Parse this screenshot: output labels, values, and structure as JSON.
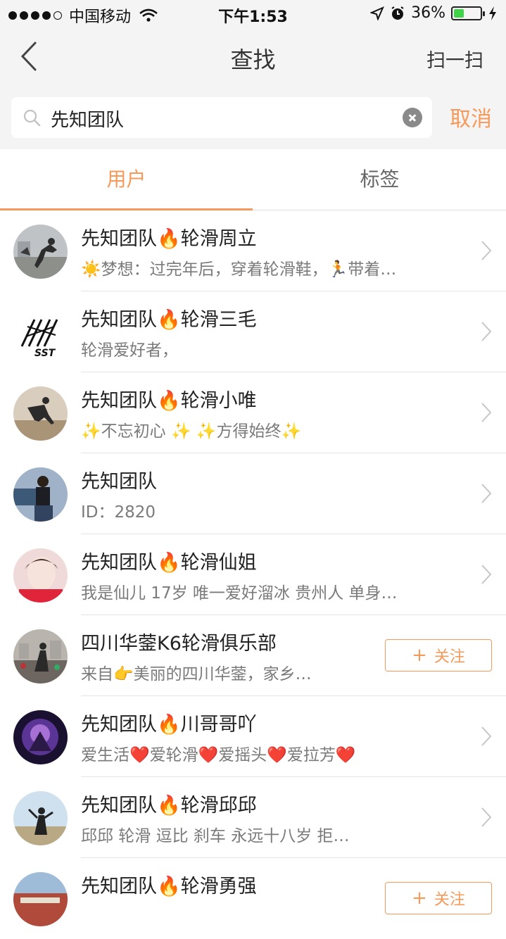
{
  "status_bar": {
    "carrier": "中国移动",
    "time": "下午1:53",
    "battery": "36%"
  },
  "nav": {
    "title": "查找",
    "scan_label": "扫一扫"
  },
  "search": {
    "value": "先知团队",
    "cancel_label": "取消"
  },
  "tabs": [
    {
      "label": "用户",
      "active": true
    },
    {
      "label": "标签",
      "active": false
    }
  ],
  "results": [
    {
      "name": "先知团队🔥轮滑周立",
      "desc": "☀️梦想：过完年后，穿着轮滑鞋，🏃带着…",
      "action": "chevron"
    },
    {
      "name": "先知团队🔥轮滑三毛",
      "desc": "轮滑爱好者，",
      "action": "chevron"
    },
    {
      "name": "先知团队🔥轮滑小唯",
      "desc": "✨不忘初心 ✨  ✨方得始终✨",
      "action": "chevron"
    },
    {
      "name": "先知团队",
      "desc": "ID：2820",
      "action": "chevron"
    },
    {
      "name": "先知团队🔥轮滑仙姐",
      "desc": "我是仙儿 17岁 唯一爱好溜冰 贵州人 单身…",
      "action": "chevron"
    },
    {
      "name": "四川华蓥K6轮滑俱乐部",
      "desc": "来自👉美丽的四川华蓥，家乡…",
      "action": "follow",
      "follow_label": "关注"
    },
    {
      "name": "先知团队🔥川哥哥吖",
      "desc": "爱生活❤️爱轮滑❤️爱摇头❤️爱拉芳❤️",
      "action": "chevron"
    },
    {
      "name": "先知团队🔥轮滑邱邱",
      "desc": "邱邱 轮滑 逗比 刹车 永远十八岁     拒…",
      "action": "chevron"
    },
    {
      "name": "先知团队🔥轮滑勇强",
      "desc": "",
      "action": "follow",
      "follow_label": "关注"
    }
  ],
  "avatar_logo_text": "SST"
}
